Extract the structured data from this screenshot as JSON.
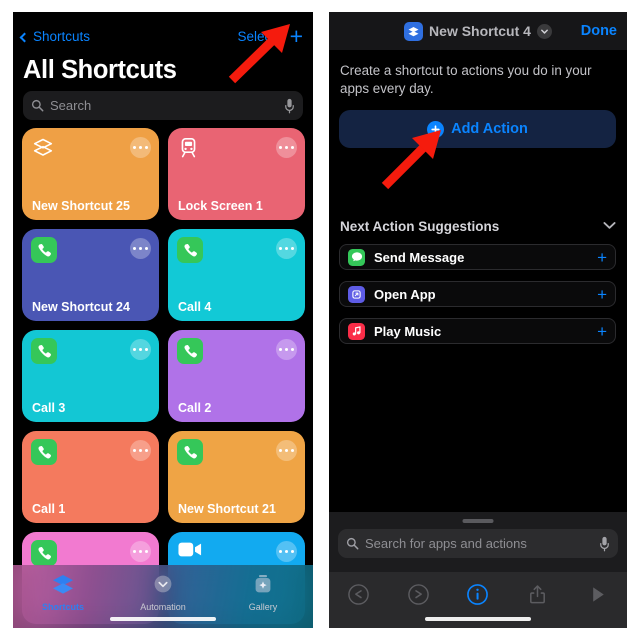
{
  "left_panel": {
    "nav": {
      "back_label": "Shortcuts",
      "back_icon": "chevron-left-icon",
      "select_label": "Select",
      "add_icon": "plus-icon"
    },
    "page_title": "All Shortcuts",
    "search": {
      "placeholder": "Search",
      "icon": "search-icon",
      "mic_icon": "microphone-icon"
    },
    "shortcuts": [
      {
        "label": "New Shortcut 25",
        "color": "#efa045",
        "icon": "shortcuts-stack-icon",
        "icon_style": "plain"
      },
      {
        "label": "Lock Screen 1",
        "color": "#e96473",
        "icon": "train-icon",
        "icon_style": "plain"
      },
      {
        "label": "New Shortcut 24",
        "color": "#4a56b4",
        "icon": "phone-icon",
        "icon_style": "app",
        "icon_bg": "#35c759"
      },
      {
        "label": "Call 4",
        "color": "#12c9d6",
        "icon": "phone-icon",
        "icon_style": "app",
        "icon_bg": "#35c759"
      },
      {
        "label": "Call 3",
        "color": "#13c7d4",
        "icon": "phone-icon",
        "icon_style": "app",
        "icon_bg": "#35c759"
      },
      {
        "label": "Call 2",
        "color": "#b072e8",
        "icon": "phone-icon",
        "icon_style": "app",
        "icon_bg": "#35c759"
      },
      {
        "label": "Call 1",
        "color": "#f47a5e",
        "icon": "phone-icon",
        "icon_style": "app",
        "icon_bg": "#35c759"
      },
      {
        "label": "New Shortcut 21",
        "color": "#efa445",
        "icon": "phone-icon",
        "icon_style": "app",
        "icon_bg": "#35c759"
      },
      {
        "label": "",
        "color": "#f27ad0",
        "icon": "phone-icon",
        "icon_style": "app",
        "icon_bg": "#35c759"
      },
      {
        "label": "",
        "color": "#12aaf0",
        "icon": "facetime-video-icon",
        "icon_style": "plain"
      }
    ],
    "tabs": [
      {
        "label": "Shortcuts",
        "icon": "shortcuts-stack-icon",
        "active": true
      },
      {
        "label": "Automation",
        "icon": "automation-clock-icon",
        "active": false
      },
      {
        "label": "Gallery",
        "icon": "gallery-icon",
        "active": false
      }
    ]
  },
  "right_panel": {
    "header": {
      "icon": "shortcuts-stack-icon",
      "title": "New Shortcut 4",
      "chevron_icon": "chevron-down-icon",
      "done_label": "Done"
    },
    "description": "Create a shortcut to actions you do in your apps every day.",
    "add_action": {
      "label": "Add Action",
      "icon": "plus-circle-icon"
    },
    "suggestions_header": {
      "title": "Next Action Suggestions",
      "chevron_icon": "chevron-down-icon"
    },
    "suggestions": [
      {
        "label": "Send Message",
        "icon": "messages-icon",
        "icon_bg": "#34c759",
        "add_icon": "plus-icon"
      },
      {
        "label": "Open App",
        "icon": "open-app-icon",
        "icon_bg": "#5e5ce6",
        "add_icon": "plus-icon"
      },
      {
        "label": "Play Music",
        "icon": "music-note-icon",
        "icon_bg": "#fa2d48",
        "add_icon": "plus-icon"
      }
    ],
    "search": {
      "placeholder": "Search for apps and actions",
      "icon": "search-icon",
      "mic_icon": "microphone-icon"
    },
    "toolbar": [
      {
        "icon": "undo-icon",
        "active": false
      },
      {
        "icon": "redo-icon",
        "active": false
      },
      {
        "icon": "info-icon",
        "active": true
      },
      {
        "icon": "share-icon",
        "active": false
      },
      {
        "icon": "play-icon",
        "active": false
      }
    ]
  },
  "annotations": {
    "arrow_color": "#f51b0d",
    "arrows": [
      {
        "name": "arrow-to-plus-button",
        "points_to": "plus-icon"
      },
      {
        "name": "arrow-to-add-action",
        "points_to": "add-action-button"
      }
    ]
  }
}
